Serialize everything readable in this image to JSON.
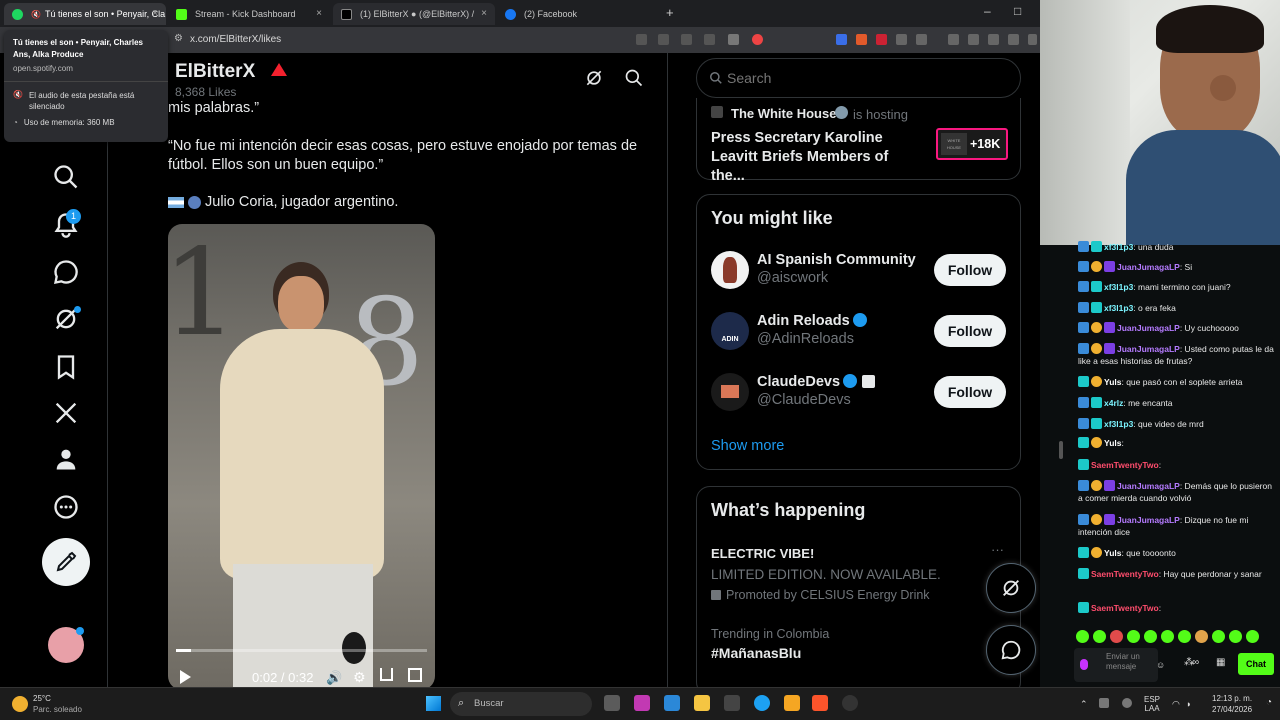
{
  "tabs": [
    {
      "title": "Tú tienes el son • Penyair, Cla",
      "close": "×"
    },
    {
      "title": "Stream - Kick Dashboard",
      "close": "×"
    },
    {
      "title": "(1) ElBitterX ● (@ElBitterX) /",
      "close": "×"
    },
    {
      "title": "(2) Facebook",
      "close": ""
    }
  ],
  "new_tab": "+",
  "window": {
    "minimize": "–",
    "maximize": "□"
  },
  "address": {
    "url": "x.com/ElBitterX/likes"
  },
  "tooltip": {
    "title": "Tú tienes el son • Penyair, Charles Ans, Alka Produce",
    "domain": "open.spotify.com",
    "audio": "El audio de esta pestaña está silenciado",
    "memory": "Uso de memoria: 360 MB"
  },
  "profile": {
    "name": "ElBitterX",
    "likes": "8,368 Likes"
  },
  "notif_count": "1",
  "tweet": {
    "line0": "mis palabras.”",
    "quote": "“No fue mi intención decir esas cosas, pero estuve enojado por temas de fútbol. Ellos son un buen equipo.”",
    "attribution": "Julio Coria, jugador argentino.",
    "video_time": "0:02 / 0:32",
    "progress": 0.06
  },
  "search": {
    "placeholder": "Search"
  },
  "live": {
    "host": "The White House",
    "hosting": "is hosting",
    "title": "Press Secretary Karoline Leavitt Briefs Members of the...",
    "count": "+18K",
    "thumb_text": "WHITE HOUSE"
  },
  "might_like": {
    "heading": "You might like",
    "follow_label": "Follow",
    "show_more": "Show more",
    "items": [
      {
        "name": "AI Spanish Community",
        "handle": "@aiscwork",
        "verified": false
      },
      {
        "name": "Adin Reloads",
        "handle": "@AdinReloads",
        "verified": true
      },
      {
        "name": "ClaudeDevs",
        "handle": "@ClaudeDevs",
        "verified": true
      }
    ]
  },
  "happening": {
    "heading": "What’s happening",
    "ad_title": "ELECTRIC VIBE!",
    "ad_sub": "LIMITED EDITION. NOW AVAILABLE.",
    "ad_promo": "Promoted by CELSIUS Energy Drink",
    "more": "···",
    "trend_context": "Trending in Colombia",
    "trend_tag": "#MañanasBlu"
  },
  "chat": {
    "messages": [
      {
        "user": "xf3l1p3",
        "text": ": una duda",
        "color": "cyan"
      },
      {
        "user": "JuanJumagaLP",
        "text": ": Si",
        "color": "purple"
      },
      {
        "user": "xf3l1p3",
        "text": ": mami termino con juani?",
        "color": "cyan"
      },
      {
        "user": "xf3l1p3",
        "text": ": o era feka",
        "color": "cyan"
      },
      {
        "user": "JuanJumagaLP",
        "text": ": Uy cuchooooo",
        "color": "purple"
      },
      {
        "user": "JuanJumagaLP",
        "text": ": Usted como putas le da like a esas historias de frutas?",
        "color": "purple"
      },
      {
        "user": "Yuls",
        "text": ": que pasó con el soplete arrieta",
        "color": "white"
      },
      {
        "user": "x4rlz",
        "text": ": me encanta",
        "color": "cyan"
      },
      {
        "user": "xf3l1p3",
        "text": ": que video de mrd",
        "color": "cyan"
      },
      {
        "user": "Yuls",
        "text": ":",
        "color": "white"
      },
      {
        "user": "SaemTwentyTwo",
        "text": ":",
        "color": "red"
      },
      {
        "user": "JuanJumagaLP",
        "text": ": Demás que lo pusieron a comer mierda cuando volvió",
        "color": "purple"
      },
      {
        "user": "JuanJumagaLP",
        "text": ": Dizque no fue mi intención dice",
        "color": "purple"
      },
      {
        "user": "Yuls",
        "text": ": que toooonto",
        "color": "white"
      },
      {
        "user": "SaemTwentyTwo",
        "text": ": Hay que perdonar y sanar",
        "color": "red"
      },
      {
        "user": "SaemTwentyTwo",
        "text": ":",
        "color": "red"
      }
    ],
    "input_placeholder": "Enviar un mensaje",
    "send_label": "Chat"
  },
  "taskbar": {
    "weather_temp": "25°C",
    "weather_desc": "Parc. soleado",
    "search_placeholder": "Buscar",
    "lang1": "ESP",
    "lang2": "LAA",
    "time": "12:13 p. m.",
    "date": "27/04/2026"
  },
  "colors": {
    "accent_blue": "#1d9bf0",
    "kick_green": "#53fc18",
    "live_red": "#f4212e"
  }
}
